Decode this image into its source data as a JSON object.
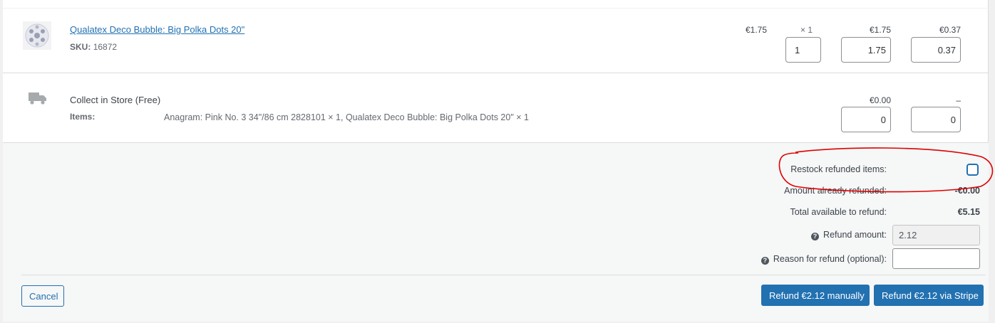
{
  "item": {
    "name": "Qualatex Deco Bubble: Big Polka Dots 20\"",
    "sku_label": "SKU:",
    "sku_value": "16872",
    "cost": "€1.75",
    "qty": "× 1",
    "total": "€1.75",
    "tax": "€0.37",
    "refund_qty": "1",
    "refund_total": "1.75",
    "refund_tax": "0.37"
  },
  "shipping": {
    "method": "Collect in Store (Free)",
    "items_label": "Items:",
    "items_value": "Anagram: Pink No. 3 34\"/86 cm 2828101 × 1, Qualatex Deco Bubble: Big Polka Dots 20\" × 1",
    "total": "€0.00",
    "tax": "–",
    "refund_total": "0",
    "refund_tax": "0"
  },
  "refund": {
    "restock_label": "Restock refunded items:",
    "restock_checked": false,
    "already_refunded_label": "Amount already refunded:",
    "already_refunded_value": "-€0.00",
    "available_label": "Total available to refund:",
    "available_value": "€5.15",
    "amount_label": "Refund amount:",
    "amount_value": "2.12",
    "reason_label": "Reason for refund (optional):",
    "reason_value": "",
    "help_icon": "question-circle-icon"
  },
  "buttons": {
    "cancel": "Cancel",
    "refund_manual": "Refund €2.12 manually",
    "refund_stripe": "Refund €2.12 via Stripe"
  },
  "colors": {
    "primary": "#2271b1",
    "annotation": "#e00000"
  }
}
